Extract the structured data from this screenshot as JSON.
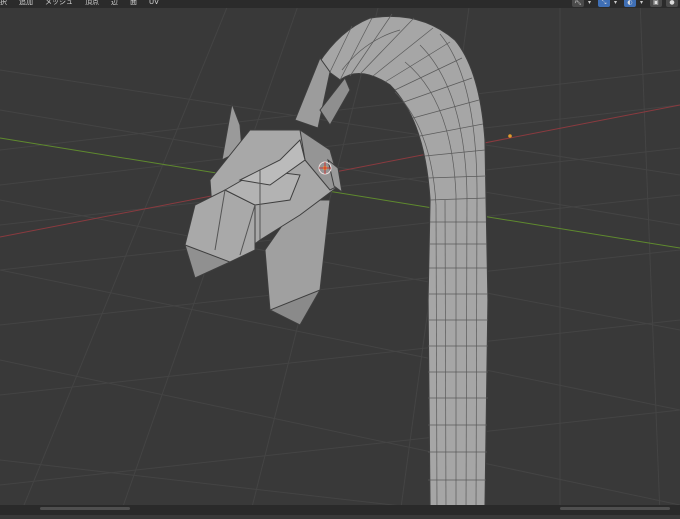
{
  "header": {
    "menu": [
      "択",
      "追加",
      "メッシュ",
      "頂点",
      "辺",
      "面",
      "UV"
    ]
  },
  "icons": {
    "snap": "magnet-icon",
    "proportional": "proportional-edit-icon",
    "overlay": "overlay-icon",
    "xray": "xray-icon",
    "shading": "solid-shading-icon"
  },
  "colors": {
    "background": "#393939",
    "grid": "#434343",
    "x_axis": "#8a3a3f",
    "y_axis": "#5f8a2e",
    "mesh": "#a7a7a7",
    "wire": "#4a4a4a"
  }
}
